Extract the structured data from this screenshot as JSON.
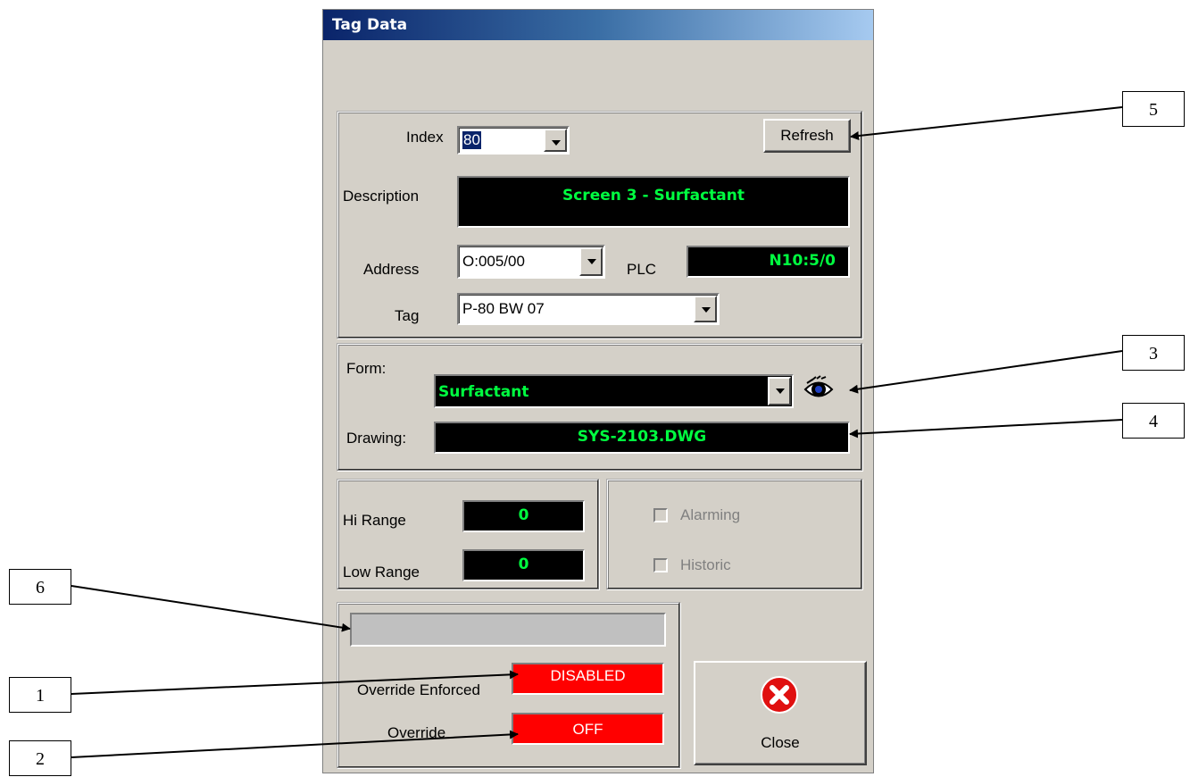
{
  "window": {
    "title": "Tag Data"
  },
  "tag_section": {
    "index_label": "Index",
    "index_value": "80",
    "refresh_label": "Refresh",
    "description_label": "Description",
    "description_value": "Screen 3 - Surfactant",
    "address_label": "Address",
    "address_value": "O:005/00",
    "plc_label": "PLC",
    "plc_value": "N10:5/0",
    "tag_label": "Tag",
    "tag_value": "P-80 BW 07"
  },
  "form_section": {
    "form_label": "Form:",
    "form_value": "Surfactant",
    "view_icon": "eye-icon",
    "drawing_label": "Drawing:",
    "drawing_value": "SYS-2103.DWG"
  },
  "range_section": {
    "hi_label": "Hi Range",
    "hi_value": "0",
    "low_label": "Low Range",
    "low_value": "0"
  },
  "options_section": {
    "alarming_label": "Alarming",
    "alarming_checked": false,
    "historic_label": "Historic",
    "historic_checked": false
  },
  "override_section": {
    "status_text": "",
    "enforced_label": "Override Enforced",
    "enforced_value": "DISABLED",
    "override_label": "Override",
    "override_value": "OFF"
  },
  "close_button": {
    "label": "Close",
    "icon": "close-icon"
  },
  "callouts": [
    "1",
    "2",
    "3",
    "4",
    "5",
    "6"
  ],
  "colors": {
    "panel": "#d4d0c8",
    "display_bg": "#000000",
    "display_text": "#00ff40",
    "alert_red": "#ff0000"
  }
}
